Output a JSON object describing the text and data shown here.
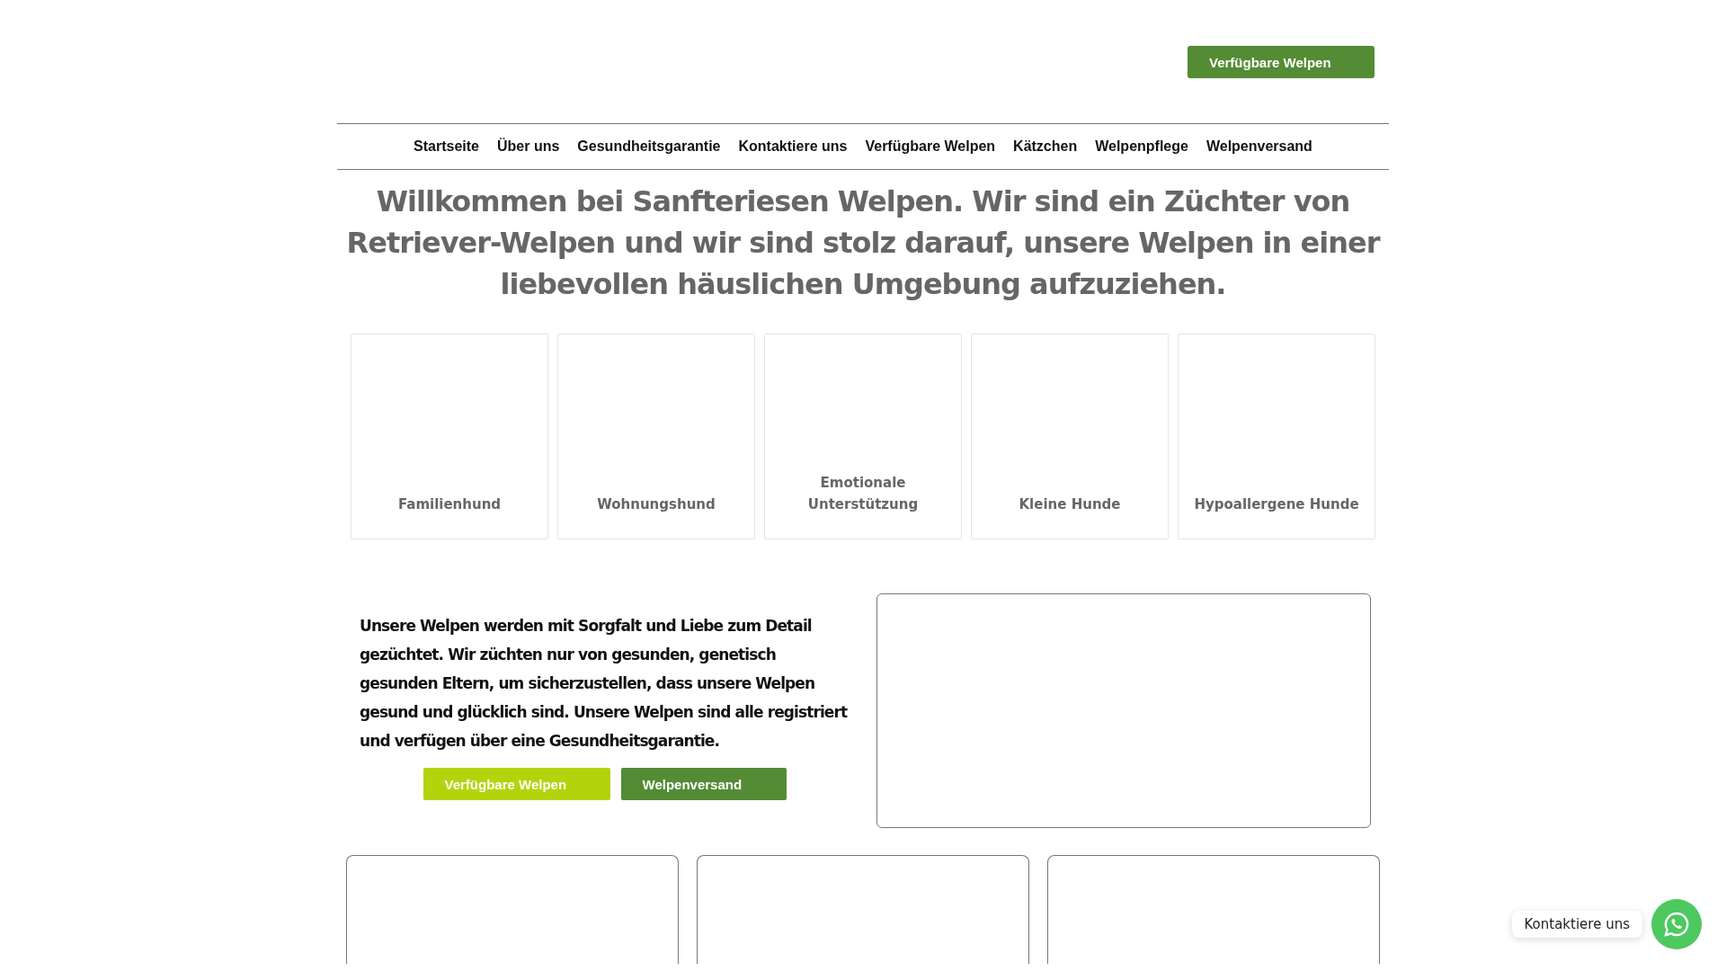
{
  "header": {
    "button": "Verfügbare Welpen"
  },
  "nav": [
    "Startseite",
    "Über uns",
    "Gesundheitsgarantie",
    "Kontaktiere uns",
    "Verfügbare Welpen",
    "Kätzchen",
    "Welpenpflege",
    "Welpenversand"
  ],
  "headline": "Willkommen bei Sanfteriesen Welpen. Wir sind ein Züchter von Retriever-Welpen und wir sind stolz darauf, unsere Welpen in einer liebevollen häuslichen Umgebung aufzuziehen.",
  "categories": [
    "Familienhund",
    "Wohnungshund",
    "Emotionale Unterstützung",
    "Kleine Hunde",
    "Hypoallergene Hunde"
  ],
  "intro": {
    "text": "Unsere Welpen werden mit Sorgfalt und Liebe zum Detail gezüchtet. Wir züchten nur von gesunden, genetisch gesunden Eltern, um sicherzustellen, dass unsere Welpen gesund und glücklich sind. Unsere Welpen sind alle registriert und verfügen über eine Gesundheitsgarantie.",
    "buttons": [
      {
        "label": "Verfügbare Welpen",
        "kind": "lime"
      },
      {
        "label": "Welpenversand",
        "kind": "green"
      }
    ]
  },
  "chat": {
    "label": "Kontaktiere uns"
  }
}
